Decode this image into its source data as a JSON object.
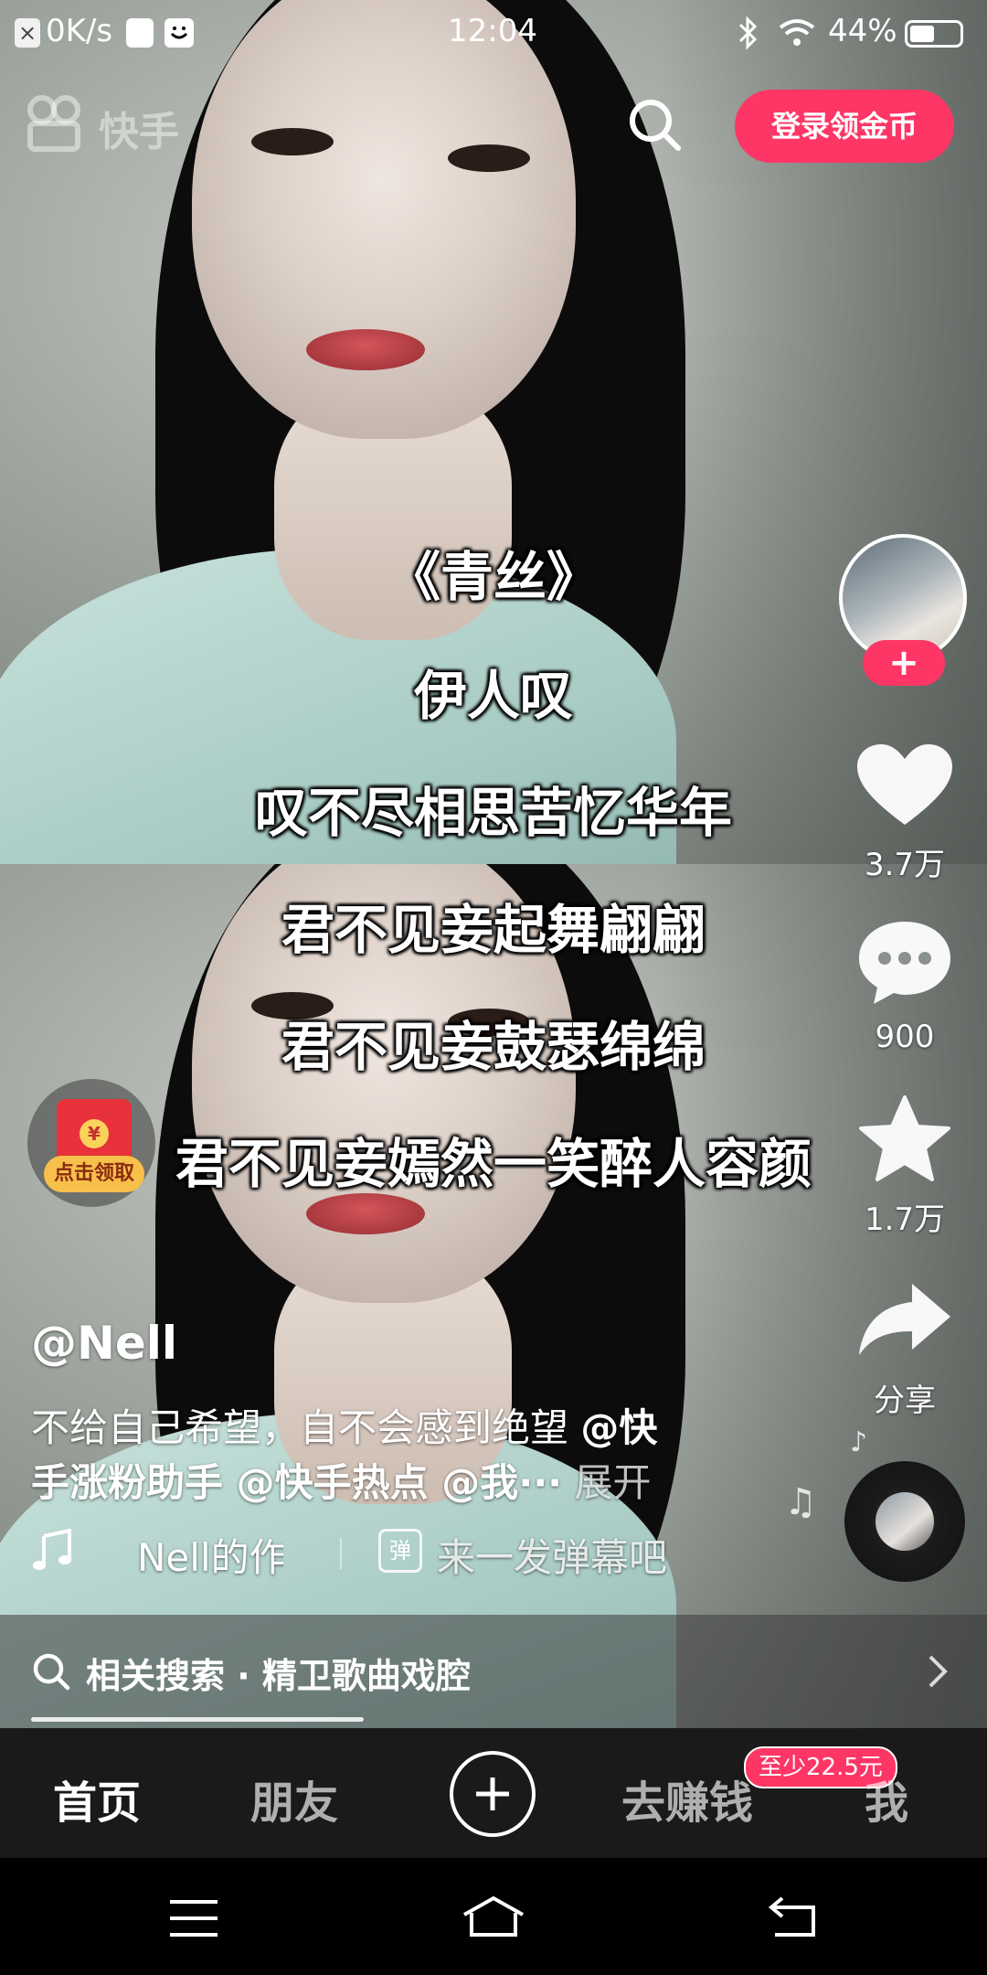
{
  "status_bar": {
    "network_speed": "0K/s",
    "time": "12:04",
    "battery": "44%",
    "icons": [
      "notification-x-icon",
      "app-icon",
      "face-app-icon",
      "bluetooth-icon",
      "wifi-icon",
      "battery-icon"
    ]
  },
  "header": {
    "logo_text": "快手",
    "login_button": "登录领金币",
    "icons": [
      "kuaishou-logo-icon",
      "search-icon"
    ]
  },
  "lyrics": [
    "《青丝》",
    "伊人叹",
    "叹不尽相思苦忆华年",
    "君不见妾起舞翩翩",
    "君不见妾鼓瑟绵绵",
    "君不见妾嫣然一笑醉人容颜"
  ],
  "right_rail": {
    "like_count": "3.7万",
    "comment_count": "900",
    "favorite_count": "1.7万",
    "share_label": "分享",
    "follow_symbol": "+",
    "icons": [
      "heart-icon",
      "comment-icon",
      "star-icon",
      "share-icon",
      "music-disc-icon"
    ]
  },
  "red_envelope": {
    "label": "点击领取",
    "coin_symbol": "¥"
  },
  "post": {
    "username": "@Nell",
    "caption_line1_text": "不给自己希望，自不会感到绝望 ",
    "caption_line1_mention": "@快",
    "caption_line2_mention": "手涨粉助手 @快手热点 @我···",
    "expand_label": "展开",
    "music_title": "Nell的作品",
    "danmu_placeholder": "来一发弹幕吧",
    "danmu_icon_char": "弹"
  },
  "related_search": {
    "text": "相关搜索 · 精卫歌曲戏腔"
  },
  "progress": {
    "fraction": 0.36
  },
  "tab_bar": {
    "tabs": [
      "首页",
      "朋友",
      "去赚钱",
      "我"
    ],
    "active": "首页",
    "earn_badge": "至少22.5元"
  },
  "colors": {
    "accent": "#fe3666",
    "tab_bar_bg": "#1a1a1a"
  }
}
